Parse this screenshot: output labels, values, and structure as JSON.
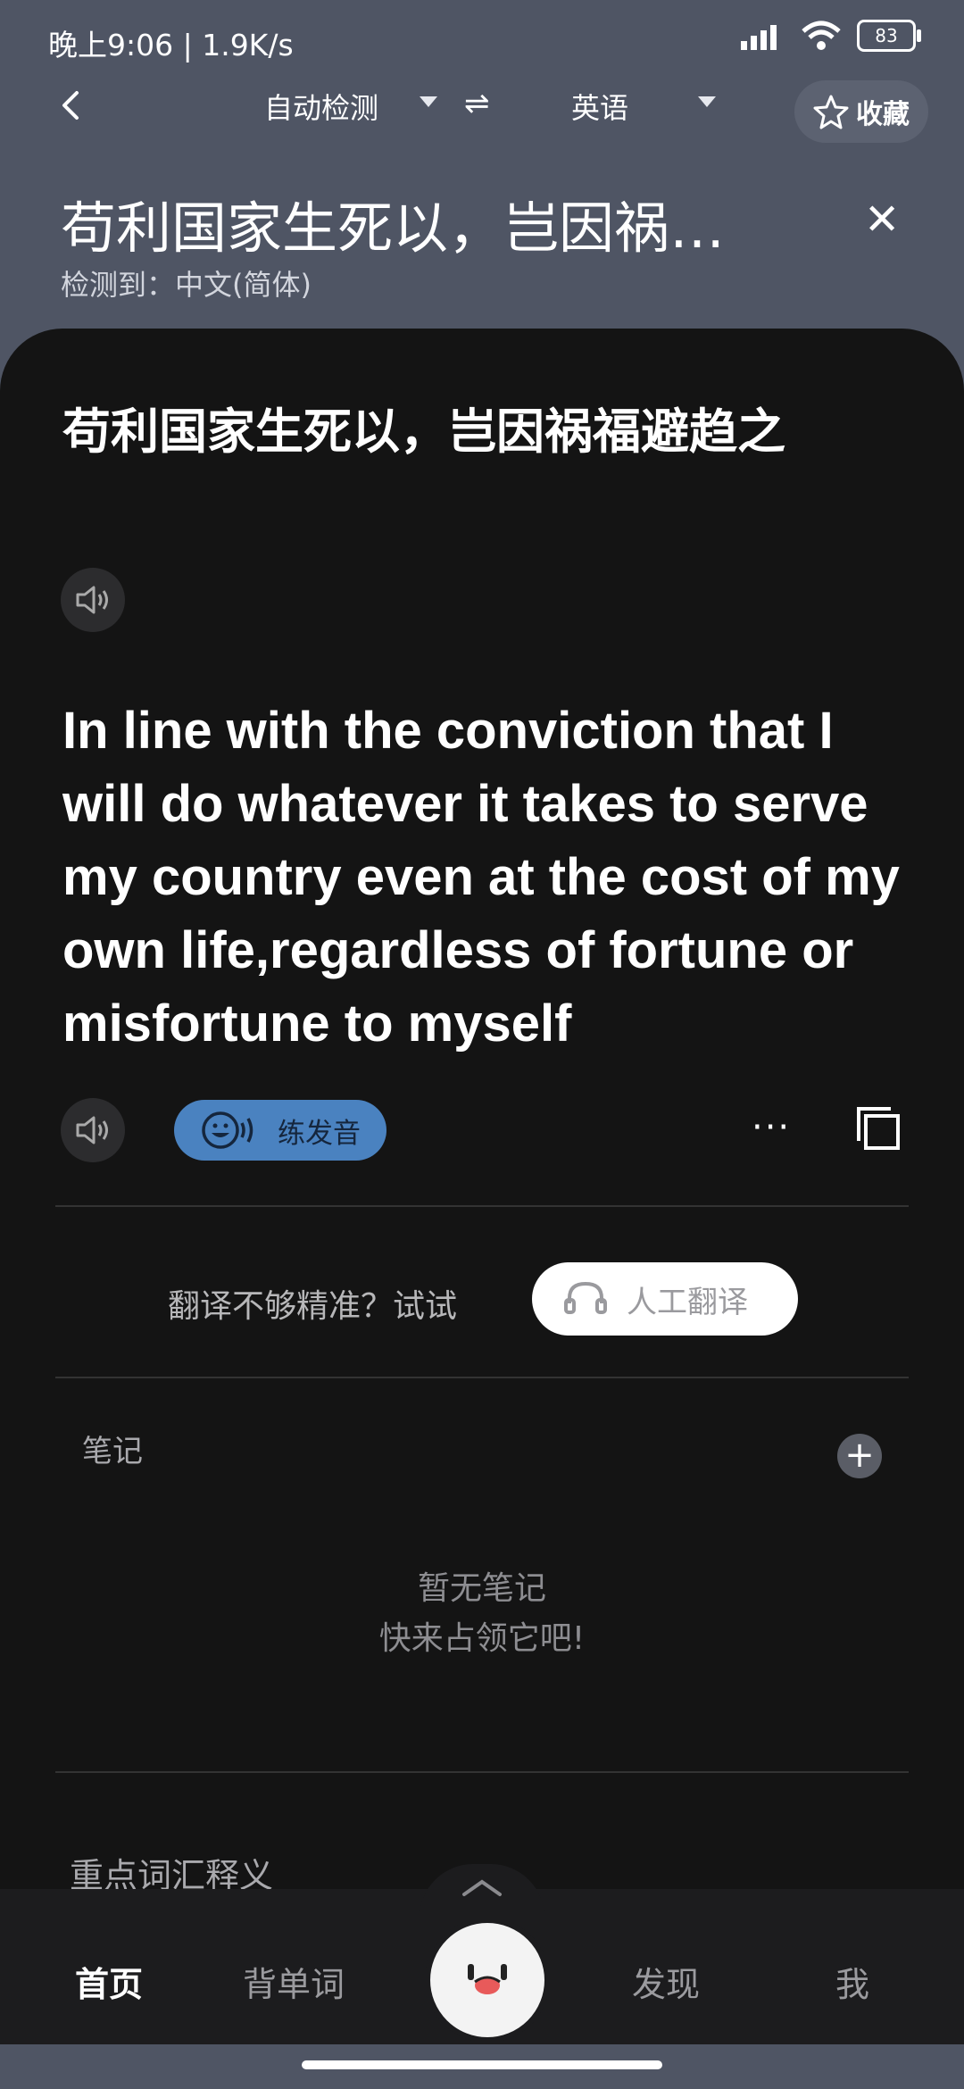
{
  "status_bar": {
    "time": "晚上9:06 | 1.9K/s",
    "battery": "83"
  },
  "nav": {
    "source_lang": "自动检测",
    "swap_symbol": "⇌",
    "target_lang": "英语",
    "favorite_label": "收藏"
  },
  "query": {
    "title": "苟利国家生死以，岂因祸…",
    "detected": "检测到：中文(简体)"
  },
  "result": {
    "source_text": "苟利国家生死以，岂因祸福避趋之",
    "translation": "In line with the conviction that I will do whatever it takes to serve my country even at the cost of my own life,regardless of fortune or misfortune to myself",
    "practice_label": "练发音",
    "more_label": "···"
  },
  "human_translation": {
    "hint": "翻译不够精准？试试",
    "button_label": "人工翻译"
  },
  "notes": {
    "label": "笔记",
    "add_label": "+",
    "empty_line1": "暂无笔记",
    "empty_line2": "快来占领它吧!"
  },
  "vocab": {
    "label": "重点词汇释义"
  },
  "bottom_nav": {
    "tabs": [
      {
        "label": "首页",
        "active": true
      },
      {
        "label": "背单词",
        "active": false
      },
      {
        "label": "发现",
        "active": false
      },
      {
        "label": "我",
        "active": false
      }
    ]
  },
  "colors": {
    "accent": "#4a82c0",
    "card_bg": "#141414",
    "header_bg": "#4f5564"
  }
}
